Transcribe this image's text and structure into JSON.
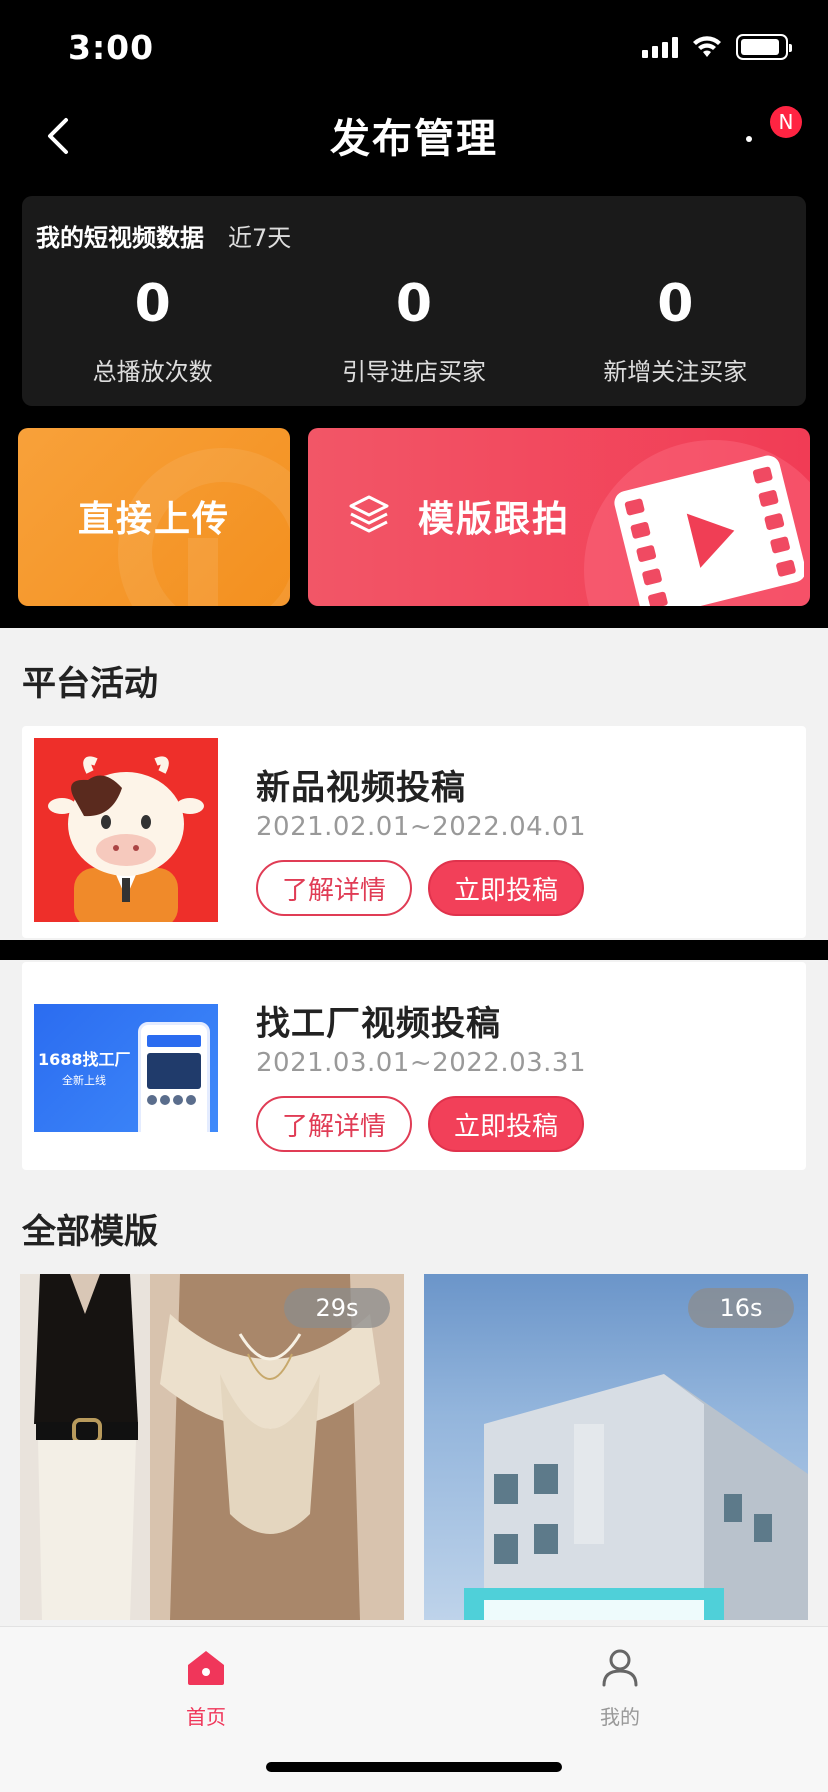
{
  "status_bar": {
    "time": "3:00"
  },
  "nav": {
    "title": "发布管理",
    "badge": "N"
  },
  "data_card": {
    "title": "我的短视频数据",
    "period": "近7天",
    "stats": [
      {
        "value": "0",
        "label": "总播放次数"
      },
      {
        "value": "0",
        "label": "引导进店买家"
      },
      {
        "value": "0",
        "label": "新增关注买家"
      }
    ]
  },
  "actions": {
    "upload_label": "直接上传",
    "template_label": "模版跟拍"
  },
  "activities": {
    "title": "平台活动",
    "items": [
      {
        "title": "新品视频投稿",
        "dates": "2021.02.01~2022.04.01",
        "details_label": "了解详情",
        "submit_label": "立即投稿"
      },
      {
        "title": "找工厂视频投稿",
        "dates": "2021.03.01~2022.03.31",
        "details_label": "了解详情",
        "submit_label": "立即投稿",
        "thumb_text": "1688找工厂",
        "thumb_sub": "全新上线"
      }
    ]
  },
  "templates": {
    "title": "全部模版",
    "items": [
      {
        "duration": "29s"
      },
      {
        "duration": "16s"
      }
    ]
  },
  "tab_bar": {
    "items": [
      {
        "label": "首页",
        "icon": "home-icon",
        "active": true
      },
      {
        "label": "我的",
        "icon": "person-icon",
        "active": false
      }
    ]
  },
  "colors": {
    "accent": "#f0365a",
    "orange": "#f59a2e",
    "red": "#f24059"
  }
}
